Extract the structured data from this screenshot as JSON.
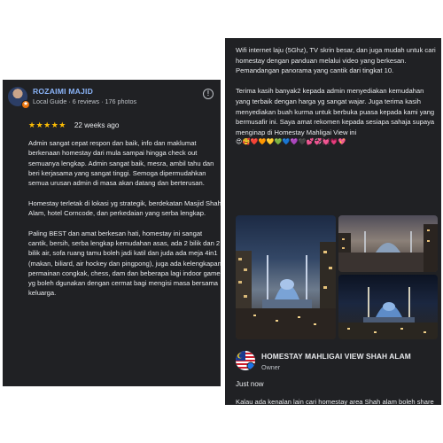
{
  "left": {
    "reviewer": {
      "name": "ROZAIMI MAJID",
      "meta": "Local Guide · 6 reviews · 176 photos",
      "badge_icon": "local-guide-star-icon",
      "more_icon": "more-options-icon"
    },
    "rating": {
      "stars": 5,
      "stars_text": "★★★★★",
      "time": "22 weeks ago"
    },
    "review_paragraphs": [
      "Admin sangat cepat respon dan baik, info dan maklumat berkenaan homestay dari mula sampai hingga check out semuanya lengkap. Admin sangat baik, mesra, ambil tahu dan beri kerjasama yang sangat tinggi. Semoga dipermudahkan semua urusan admin di masa akan datang dan berterusan.",
      "Homestay terletak di lokasi yg strategik, berdekatan Masjid Shah Alam, hotel Corncode, dan perkedaian yang serba lengkap.",
      "Paling BEST dan amat berkesan hati, homestay ini sangat cantik, bersih, serba lengkap kemudahan asas, ada 2 bilik dan 2 bilik air, sofa ruang tamu boleh jadi katil dan juda ada meja 4in1 (makan, biliard, air hockey dan pingpong), juga ada kelengkapan permainan congkak, chess, dam dan beberapa lagi indoor game yg boleh dgunakan dengan cermat bagi mengisi masa bersama keluarga."
    ]
  },
  "right": {
    "paragraphs": [
      "Wifi internet laju (5Ghz), TV skrin besar, dan juga mudah untuk cari homestay dengan panduan melalui video yang berkesan. Pemandangan panorama yang cantik dari tingkat 10.",
      "Terima kasih banyak2 kepada admin menyediakan kemudahan yang terbaik dengan harga yg sangat wajar. Juga terima kasih menyediakan buah kurma untuk berbuka puasa kepada kami yang bermusafir ini. Saya amat rekomen kepada sesiapa sahaja supaya menginap di Homestay Mahligai View ini"
    ],
    "emoji_line": "😍🥰❤️🧡💛💚💙💜🖤💕💞💓💗💖",
    "photos": [
      {
        "name": "photo-mosque-night-view"
      },
      {
        "name": "photo-mosque-dusk-view"
      },
      {
        "name": "photo-mosque-lit-view"
      }
    ],
    "owner": {
      "name": "HOMESTAY MAHLIGAI VIEW SHAH ALAM",
      "label": "Owner",
      "reply_time": "Just now",
      "reply_text": "Kalau ada kenalan lain cari homestay area Shah alam boleh share *MAHLIGAI VIEW HOMESTAY* ye.🥰✌️"
    }
  },
  "colors": {
    "panel_bg": "#202124",
    "text": "#e8eaed",
    "secondary_text": "#bdc1c6",
    "reviewer_name": "#8ab4f8",
    "star": "#fbbc04",
    "local_guide_badge": "#e8710a"
  }
}
